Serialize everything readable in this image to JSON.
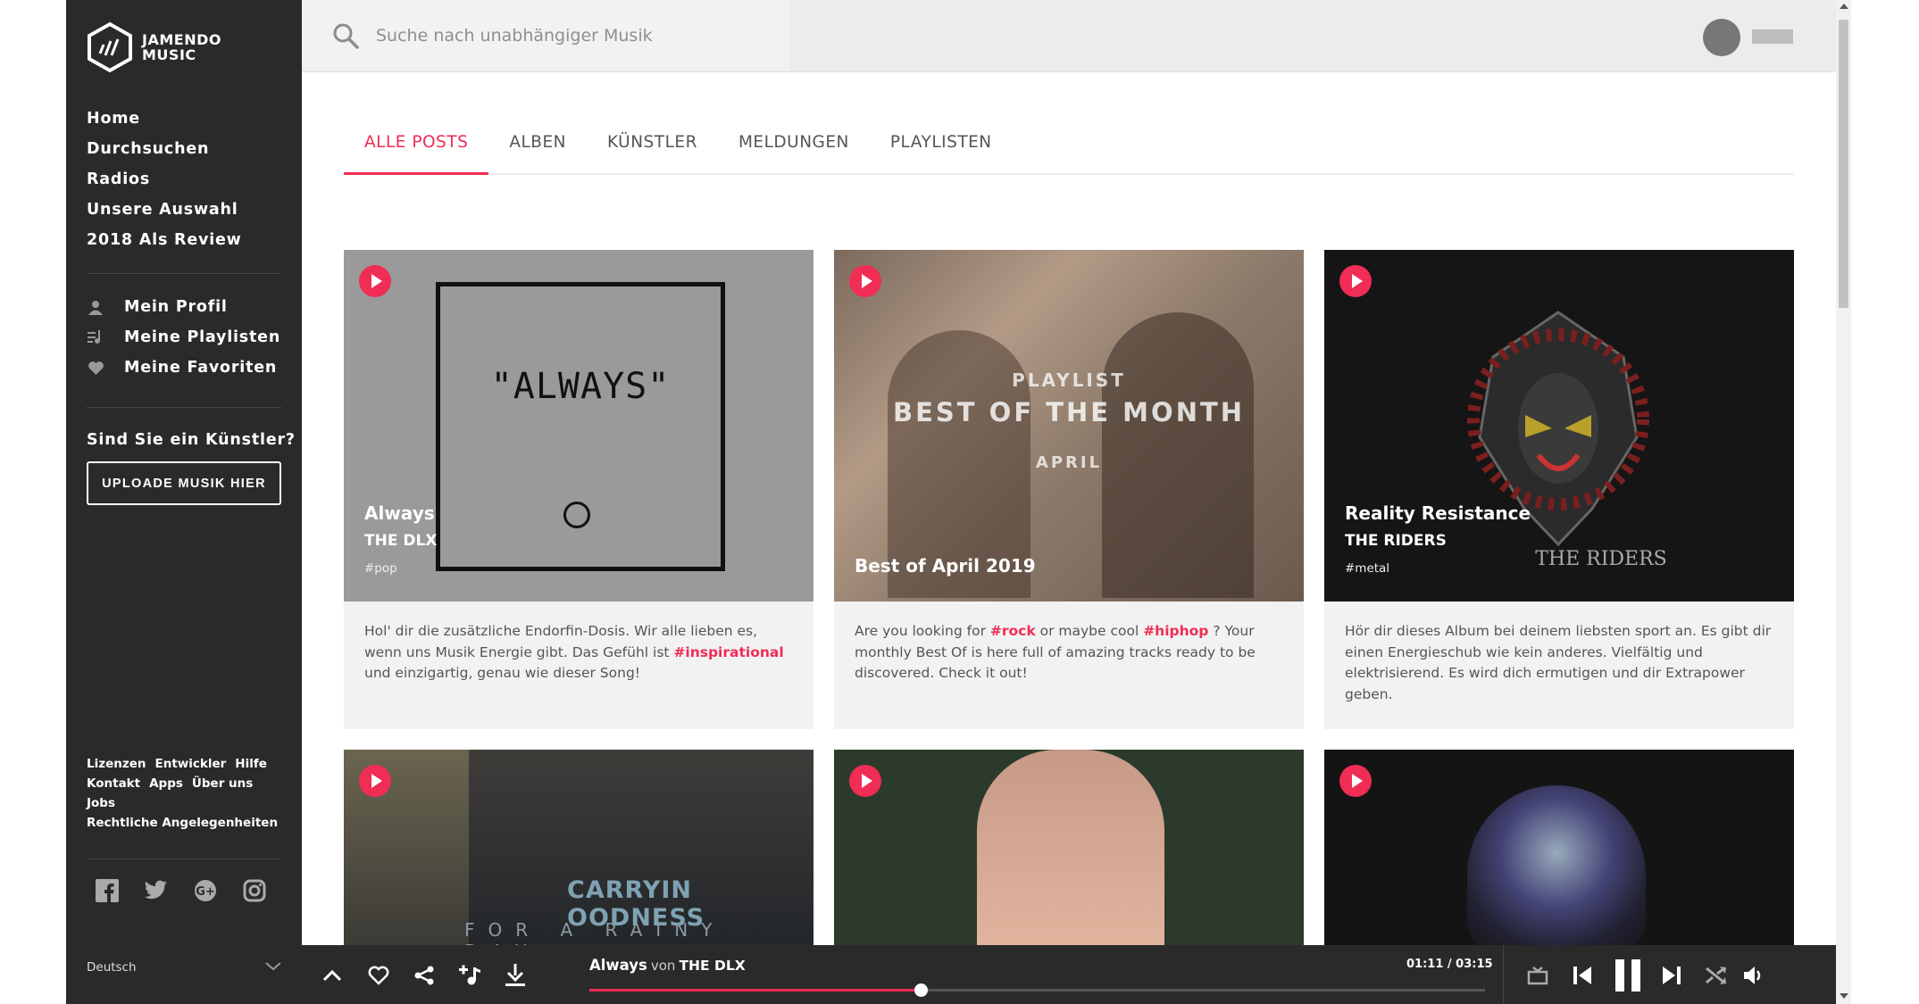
{
  "brand": {
    "line1": "JAMENDO",
    "line2": "MUSIC"
  },
  "sidebar": {
    "main_nav": [
      "Home",
      "Durchsuchen",
      "Radios",
      "Unsere Auswahl",
      "2018 Als Review"
    ],
    "user_nav": [
      {
        "label": "Mein Profil",
        "icon": "user-icon"
      },
      {
        "label": "Meine Playlisten",
        "icon": "playlist-icon"
      },
      {
        "label": "Meine Favoriten",
        "icon": "heart-icon"
      }
    ],
    "artist_question": "Sind Sie ein Künstler?",
    "upload_label": "UPLOADE MUSIK HIER",
    "footer_links": [
      "Lizenzen",
      "Entwickler",
      "Hilfe",
      "Kontakt",
      "Apps",
      "Über uns",
      "Jobs",
      "Rechtliche Angelegenheiten"
    ],
    "social": [
      "facebook-icon",
      "twitter-icon",
      "google-plus-icon",
      "instagram-icon"
    ],
    "language": "Deutsch"
  },
  "search": {
    "placeholder": "Suche nach unabhängiger Musik"
  },
  "tabs": [
    "ALLE POSTS",
    "ALBEN",
    "KÜNSTLER",
    "MELDUNGEN",
    "PLAYLISTEN"
  ],
  "active_tab": "ALLE POSTS",
  "cards": [
    {
      "cover_text": "\"ALWAYS\"",
      "title": "Always",
      "artist": "THE DLX",
      "tag": "#pop",
      "desc_1": "Hol' dir die zusätzliche Endorfin-Dosis. Wir alle lieben es, wenn uns Musik Energie gibt. Das Gefühl ist ",
      "desc_hl_1": "#inspirational",
      "desc_2": " und einzigartig, genau wie dieser Song!"
    },
    {
      "cover_small": "PLAYLIST",
      "cover_big": "BEST OF THE MONTH",
      "cover_month": "APRIL",
      "title": "Best of April 2019",
      "desc_1": "Are you looking for ",
      "desc_hl_1": "#rock",
      "desc_2": " or maybe cool ",
      "desc_hl_2": "#hiphop",
      "desc_3": " ? Your monthly Best Of is here full of amazing tracks ready to be discovered. Check it out!"
    },
    {
      "cover_text": "THE RIDERS",
      "title": "Reality Resistance",
      "artist": "THE RIDERS",
      "tag": "#metal",
      "desc_1": "Hör dir dieses Album bei deinem liebsten sport an. Es gibt dir einen Energieschub wie kein anderes. Vielfältig und elektrisierend. Es wird dich ermutigen und dir Extrapower geben."
    }
  ],
  "row2": {
    "cover_line1": "CARRYIN  OODNESS",
    "cover_line2": "FOR A RAINY DAY"
  },
  "player": {
    "title": "Always",
    "von": "von",
    "artist": "THE DLX",
    "time": "01:11 / 03:15",
    "progress": 0.37
  },
  "colors": {
    "accent": "#f02d55",
    "sidebar": "#2a2a2a"
  }
}
